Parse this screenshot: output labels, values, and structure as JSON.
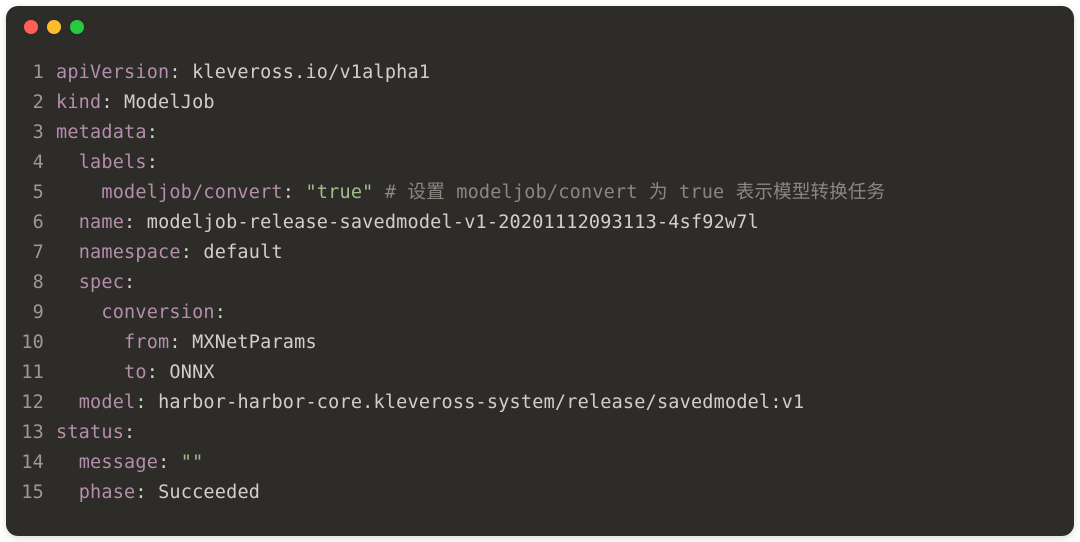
{
  "titlebar": {
    "dot_red": "close",
    "dot_yellow": "minimize",
    "dot_green": "zoom"
  },
  "lines": [
    {
      "n": "1",
      "segments": [
        {
          "cls": "key",
          "t": "apiVersion"
        },
        {
          "cls": "punct",
          "t": ": "
        },
        {
          "cls": "val",
          "t": "kleveross.io/v1alpha1"
        }
      ]
    },
    {
      "n": "2",
      "segments": [
        {
          "cls": "key",
          "t": "kind"
        },
        {
          "cls": "punct",
          "t": ": "
        },
        {
          "cls": "val",
          "t": "ModelJob"
        }
      ]
    },
    {
      "n": "3",
      "segments": [
        {
          "cls": "key",
          "t": "metadata"
        },
        {
          "cls": "punct",
          "t": ":"
        }
      ]
    },
    {
      "n": "4",
      "segments": [
        {
          "cls": "val",
          "t": "  "
        },
        {
          "cls": "key",
          "t": "labels"
        },
        {
          "cls": "punct",
          "t": ":"
        }
      ]
    },
    {
      "n": "5",
      "segments": [
        {
          "cls": "val",
          "t": "    "
        },
        {
          "cls": "key",
          "t": "modeljob/convert"
        },
        {
          "cls": "punct",
          "t": ": "
        },
        {
          "cls": "str",
          "t": "\"true\""
        },
        {
          "cls": "val",
          "t": " "
        },
        {
          "cls": "comment",
          "t": "# 设置 modeljob/convert 为 true 表示模型转换任务"
        }
      ]
    },
    {
      "n": "6",
      "segments": [
        {
          "cls": "val",
          "t": "  "
        },
        {
          "cls": "key",
          "t": "name"
        },
        {
          "cls": "punct",
          "t": ": "
        },
        {
          "cls": "val",
          "t": "modeljob-release-savedmodel-v1-20201112093113-4sf92w7l"
        }
      ]
    },
    {
      "n": "7",
      "segments": [
        {
          "cls": "val",
          "t": "  "
        },
        {
          "cls": "key",
          "t": "namespace"
        },
        {
          "cls": "punct",
          "t": ": "
        },
        {
          "cls": "val",
          "t": "default"
        }
      ]
    },
    {
      "n": "8",
      "segments": [
        {
          "cls": "val",
          "t": "  "
        },
        {
          "cls": "key",
          "t": "spec"
        },
        {
          "cls": "punct",
          "t": ":"
        }
      ]
    },
    {
      "n": "9",
      "segments": [
        {
          "cls": "val",
          "t": "    "
        },
        {
          "cls": "key",
          "t": "conversion"
        },
        {
          "cls": "punct",
          "t": ":"
        }
      ]
    },
    {
      "n": "10",
      "segments": [
        {
          "cls": "val",
          "t": "      "
        },
        {
          "cls": "key",
          "t": "from"
        },
        {
          "cls": "punct",
          "t": ": "
        },
        {
          "cls": "val",
          "t": "MXNetParams"
        }
      ]
    },
    {
      "n": "11",
      "segments": [
        {
          "cls": "val",
          "t": "      "
        },
        {
          "cls": "key",
          "t": "to"
        },
        {
          "cls": "punct",
          "t": ": "
        },
        {
          "cls": "val",
          "t": "ONNX"
        }
      ]
    },
    {
      "n": "12",
      "segments": [
        {
          "cls": "val",
          "t": "  "
        },
        {
          "cls": "key",
          "t": "model"
        },
        {
          "cls": "punct",
          "t": ": "
        },
        {
          "cls": "val",
          "t": "harbor-harbor-core.kleveross-system/release/savedmodel:v1"
        }
      ]
    },
    {
      "n": "13",
      "segments": [
        {
          "cls": "key",
          "t": "status"
        },
        {
          "cls": "punct",
          "t": ":"
        }
      ]
    },
    {
      "n": "14",
      "segments": [
        {
          "cls": "val",
          "t": "  "
        },
        {
          "cls": "key",
          "t": "message"
        },
        {
          "cls": "punct",
          "t": ": "
        },
        {
          "cls": "str",
          "t": "\"\""
        }
      ]
    },
    {
      "n": "15",
      "segments": [
        {
          "cls": "val",
          "t": "  "
        },
        {
          "cls": "key",
          "t": "phase"
        },
        {
          "cls": "punct",
          "t": ": "
        },
        {
          "cls": "val",
          "t": "Succeeded"
        }
      ]
    }
  ]
}
